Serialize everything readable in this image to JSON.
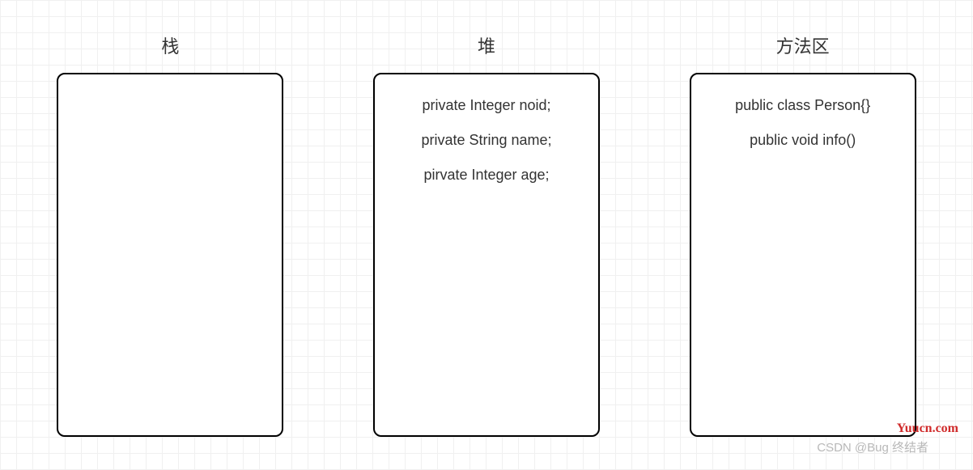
{
  "sections": {
    "stack": {
      "title": "栈",
      "items": []
    },
    "heap": {
      "title": "堆",
      "items": [
        "private Integer noid;",
        "private String name;",
        "pirvate Integer age;"
      ]
    },
    "method_area": {
      "title": "方法区",
      "items": [
        "public class Person{}",
        "public void info()"
      ]
    }
  },
  "watermark": {
    "yuucn": "Yuucn.com",
    "csdn": "CSDN @Bug 终结者"
  }
}
